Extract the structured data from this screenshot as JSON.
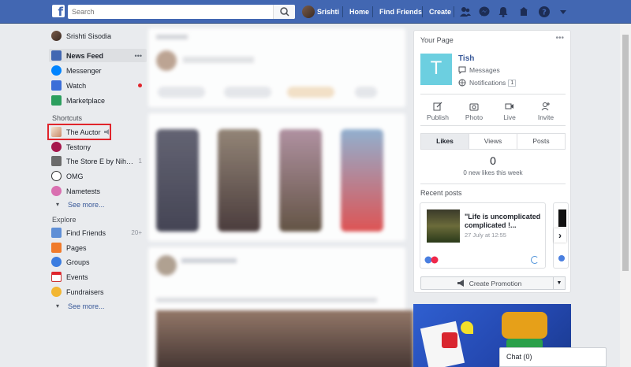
{
  "topbar": {
    "search_placeholder": "Search",
    "user_name": "Srishti",
    "nav": [
      "Home",
      "Find Friends",
      "Create"
    ],
    "icons": [
      "friends-icon",
      "messenger-icon",
      "notifications-icon",
      "help-icon",
      "caret-down-icon"
    ]
  },
  "sidebar": {
    "profile_name": "Srishti Sisodia",
    "items": [
      {
        "label": "News Feed",
        "icon": "news-feed-icon",
        "more": "•••"
      },
      {
        "label": "Messenger",
        "icon": "messenger-icon"
      },
      {
        "label": "Watch",
        "icon": "watch-icon"
      },
      {
        "label": "Marketplace",
        "icon": "marketplace-icon"
      }
    ],
    "shortcuts_title": "Shortcuts",
    "shortcuts": [
      {
        "label": "The Auctor",
        "icon": "page-avatar"
      },
      {
        "label": "Testony",
        "icon": "page-avatar"
      },
      {
        "label": "The Store E by Nih…",
        "count": "1",
        "icon": "page-avatar"
      },
      {
        "label": "OMG",
        "icon": "page-avatar"
      },
      {
        "label": "Nametests",
        "icon": "page-avatar"
      }
    ],
    "shortcuts_see_more": "See more...",
    "explore_title": "Explore",
    "explore": [
      {
        "label": "Find Friends",
        "count": "20+",
        "icon": "find-friends-icon"
      },
      {
        "label": "Pages",
        "icon": "pages-icon"
      },
      {
        "label": "Groups",
        "icon": "groups-icon"
      },
      {
        "label": "Events",
        "icon": "events-icon"
      },
      {
        "label": "Fundraisers",
        "icon": "fundraisers-icon"
      }
    ],
    "explore_see_more": "See more..."
  },
  "your_page": {
    "header": "Your Page",
    "more": "•••",
    "page_initial": "T",
    "page_name": "Tish",
    "messages_label": "Messages",
    "notifications_label": "Notifications",
    "notifications_count": "1",
    "actions": [
      "Publish",
      "Photo",
      "Live",
      "Invite"
    ],
    "tabs": [
      "Likes",
      "Views",
      "Posts"
    ],
    "likes_count": "0",
    "likes_text": "0 new likes this week",
    "recent_posts_title": "Recent posts",
    "post_title": "\"Life is uncomplicated complicated !...",
    "post_date": "27 July at 12:55",
    "promotion_label": "Create Promotion"
  },
  "chat": {
    "label": "Chat (0)"
  },
  "colors": {
    "brand": "#4267b2",
    "highlight": "#e0242b",
    "page_logo": "#6ccfe0"
  }
}
